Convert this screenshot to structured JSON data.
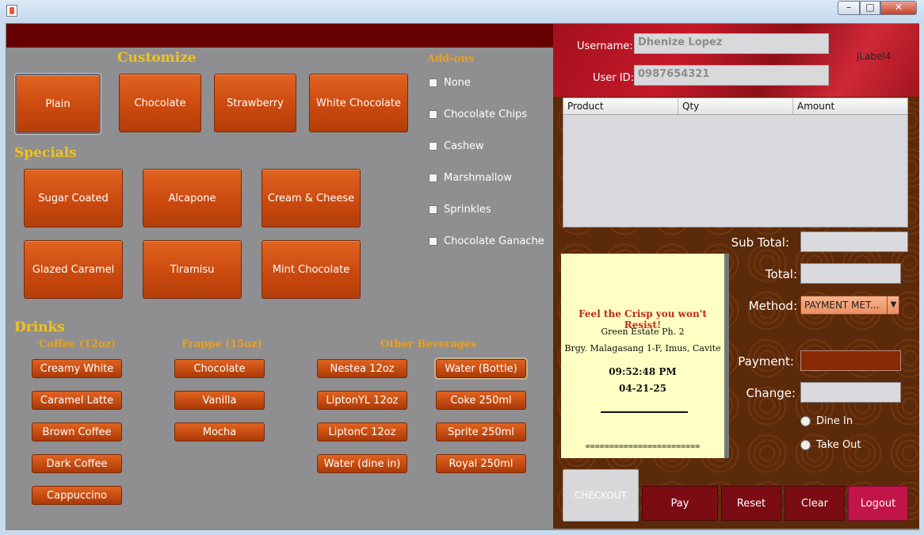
{
  "window": {
    "min": "–",
    "max": "□",
    "close": "✕"
  },
  "customize": {
    "title": "Customize",
    "items": [
      "Plain",
      "Chocolate",
      "Strawberry",
      "White Chocolate"
    ]
  },
  "specials": {
    "title": "Specials",
    "items": [
      "Sugar Coated",
      "Alcapone",
      "Cream & Cheese",
      "Glazed Caramel",
      "Tiramisu",
      "Mint Chocolate"
    ]
  },
  "addons": {
    "title": "Add-ons",
    "items": [
      "None",
      "Chocolate Chips",
      "Cashew",
      "Marshmallow",
      "Sprinkles",
      "Chocolate Ganache"
    ]
  },
  "drinks": {
    "title": "Drinks",
    "coffee_title": "Coffee (12oz)",
    "coffee": [
      "Creamy White",
      "Caramel Latte",
      "Brown Coffee",
      "Dark Coffee",
      "Cappuccino"
    ],
    "frappe_title": "Frappe (15oz)",
    "frappe": [
      "Chocolate",
      "Vanilla",
      "Mocha"
    ],
    "other_title": "Other Beverages",
    "other_left": [
      "Nestea 12oz",
      "LiptonYL 12oz",
      "LiptonC 12oz",
      "Water (dine in)"
    ],
    "other_right": [
      "Water (Bottle)",
      "Coke 250ml",
      "Sprite 250ml",
      "Royal 250ml"
    ]
  },
  "user": {
    "username_label": "Username:",
    "username": "Dhenize Lopez",
    "userid_label": "User ID:",
    "userid": "0987654321",
    "jlabel": "jLabel4"
  },
  "table": {
    "columns": [
      "Product",
      "Qty",
      "Amount"
    ]
  },
  "totals": {
    "subtotal_label": "Sub Total:",
    "total_label": "Total:",
    "method_label": "Method:",
    "method_value": "PAYMENT MET...",
    "payment_label": "Payment:",
    "change_label": "Change:"
  },
  "receipt": {
    "tagline": "Feel the Crisp you won't Resist!",
    "address1": "Green Estate Ph. 2",
    "address2": "Brgy. Malagasang 1-F, Imus, Cavite",
    "time": "09:52:48 PM",
    "date": "04-21-25",
    "divider": "========================"
  },
  "order_type": {
    "dine_in": "Dine In",
    "take_out": "Take Out"
  },
  "actions": {
    "checkout": "CHECKOUT",
    "pay": "Pay",
    "reset": "Reset",
    "clear": "Clear",
    "logout": "Logout"
  },
  "colors": {
    "accent_orange": "#c9480e",
    "title_yellow": "#f2c21b",
    "dark_red": "#7c0c14",
    "logout_pink": "#c2144a"
  }
}
